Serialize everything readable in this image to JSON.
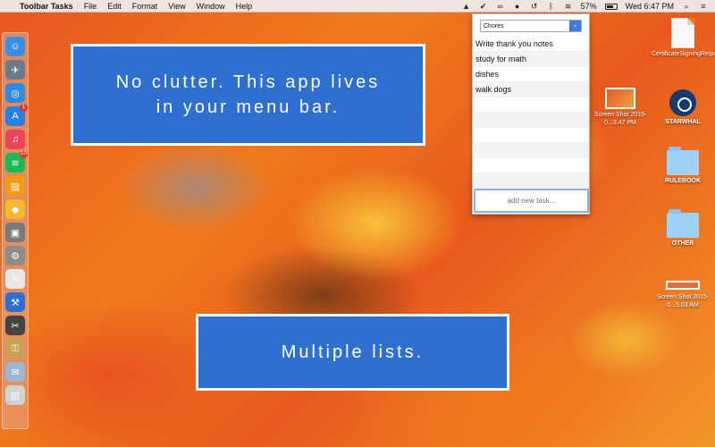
{
  "menubar": {
    "app_name": "Toolbar Tasks",
    "menus": [
      "File",
      "Edit",
      "Format",
      "View",
      "Window",
      "Help"
    ],
    "battery_percent": "57%",
    "clock": "Wed 6:47 PM",
    "status_icons": [
      "drive-icon",
      "check-circle-icon",
      "link-icon",
      "mic-icon",
      "time-machine-icon",
      "bluetooth-icon",
      "wifi-icon",
      "battery-icon",
      "search-icon",
      "list-icon"
    ]
  },
  "banners": {
    "top": "No clutter. This app lives in your menu bar.",
    "bottom": "Multiple lists."
  },
  "popover": {
    "selected_list": "Chores",
    "tasks": [
      "Write thank you notes",
      "study for math",
      "dishes",
      "walk dogs",
      "",
      "",
      "",
      "",
      "",
      ""
    ],
    "add_placeholder": "add new task..."
  },
  "dock": {
    "items": [
      {
        "icon": "finder-icon",
        "color": "#3a8ee6"
      },
      {
        "icon": "launchpad-icon",
        "color": "#6b7a8f"
      },
      {
        "icon": "safari-icon",
        "color": "#2f8be0"
      },
      {
        "icon": "app-store-icon",
        "color": "#2a7fe4",
        "badge": "1"
      },
      {
        "icon": "itunes-icon",
        "color": "#e8455a"
      },
      {
        "icon": "spotify-icon",
        "color": "#1db954",
        "badge": "10"
      },
      {
        "icon": "ibooks-icon",
        "color": "#f39c12"
      },
      {
        "icon": "sketch-icon",
        "color": "#f5b82e"
      },
      {
        "icon": "preview-icon",
        "color": "#7a7a7a"
      },
      {
        "icon": "system-preferences-icon",
        "color": "#8c8c8c"
      },
      {
        "icon": "textedit-icon",
        "color": "#e8e8e8"
      },
      {
        "icon": "xcode-icon",
        "color": "#2d6fd1"
      },
      {
        "icon": "final-cut-icon",
        "color": "#444"
      },
      {
        "icon": "keychain-icon",
        "color": "#c9a25a"
      },
      {
        "icon": "mail-icon",
        "color": "#9fb6d0"
      },
      {
        "icon": "trash-icon",
        "color": "#cfd3d6"
      }
    ]
  },
  "desktop": {
    "cert": "CertificateSigningRequ...Request",
    "screenshot1": "Screen Shot 2015-0...3.47 PM",
    "steam": "STARWHAL",
    "rulebook": "RULEBOOK",
    "other": "OTHER",
    "screenshot2": "Screen Shot 2015-0...5.03 AM"
  }
}
